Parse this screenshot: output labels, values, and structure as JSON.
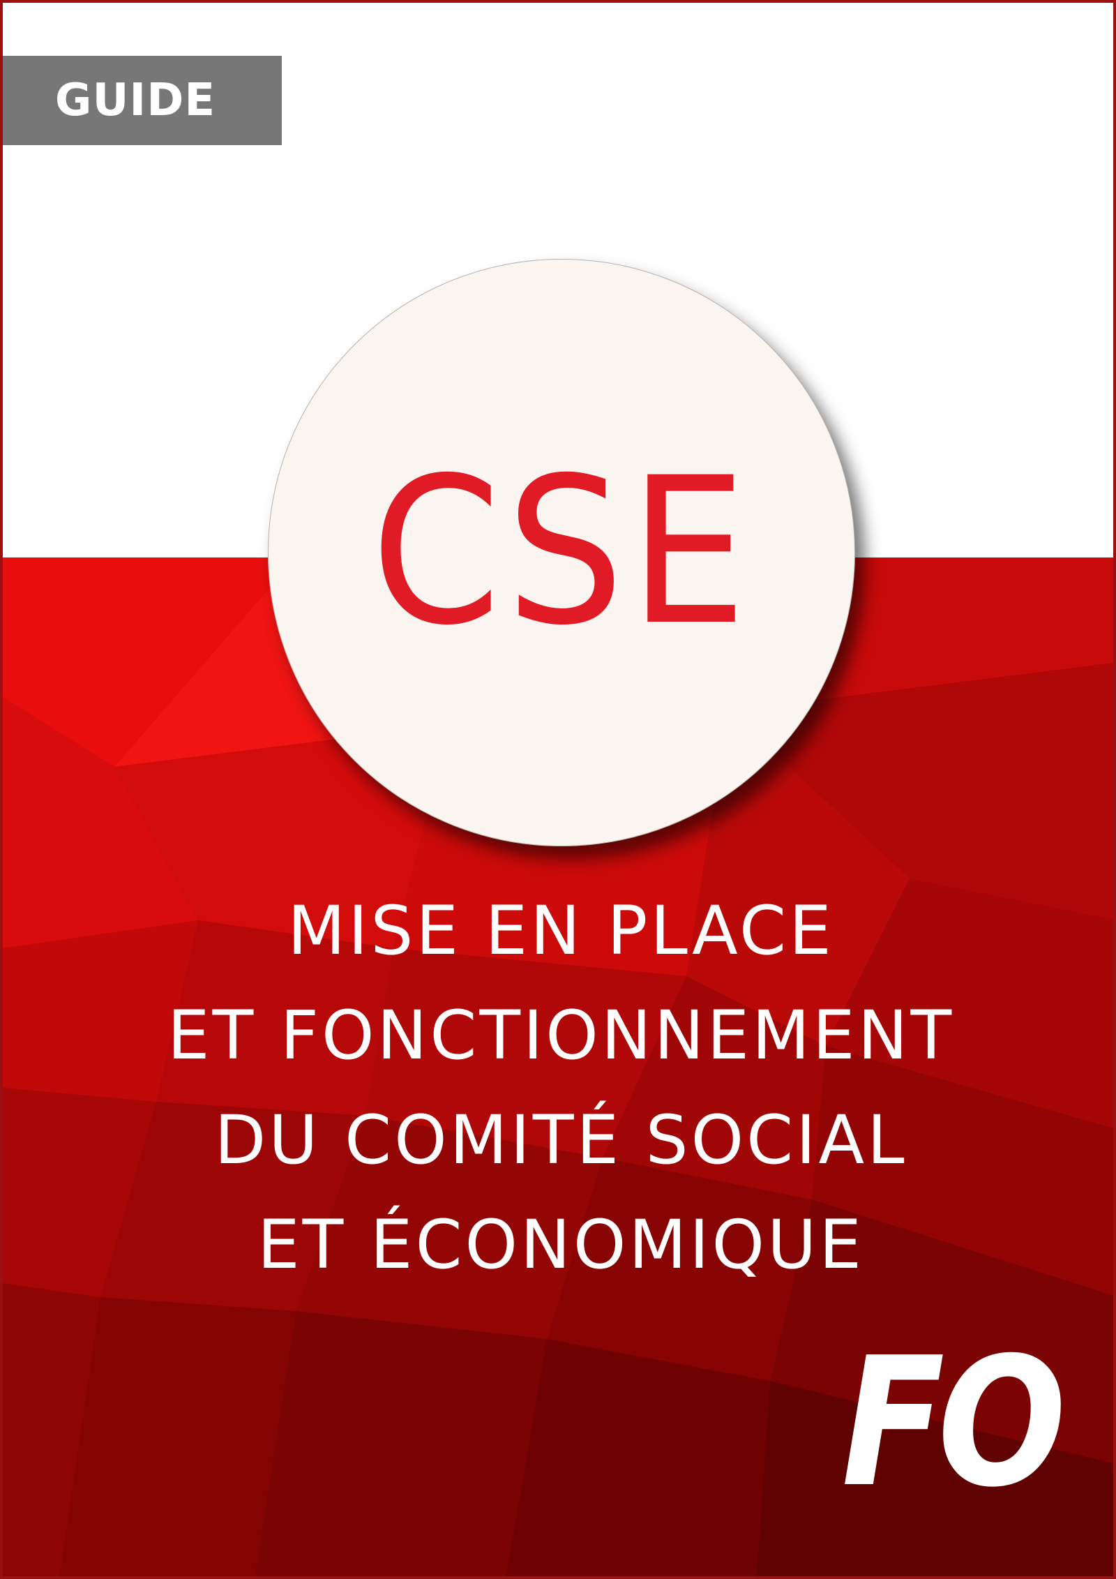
{
  "guide_label": "GUIDE",
  "acronym": "CSE",
  "title_lines": [
    "MISE EN PLACE",
    "ET FONCTIONNEMENT",
    "DU COMITÉ SOCIAL",
    "ET ÉCONOMIQUE"
  ],
  "logo_text": "FO",
  "colors": {
    "brand_red": "#e01b25",
    "background_red": "#c40808",
    "tag_gray": "#777777",
    "circle_fill": "#faf5f1"
  }
}
